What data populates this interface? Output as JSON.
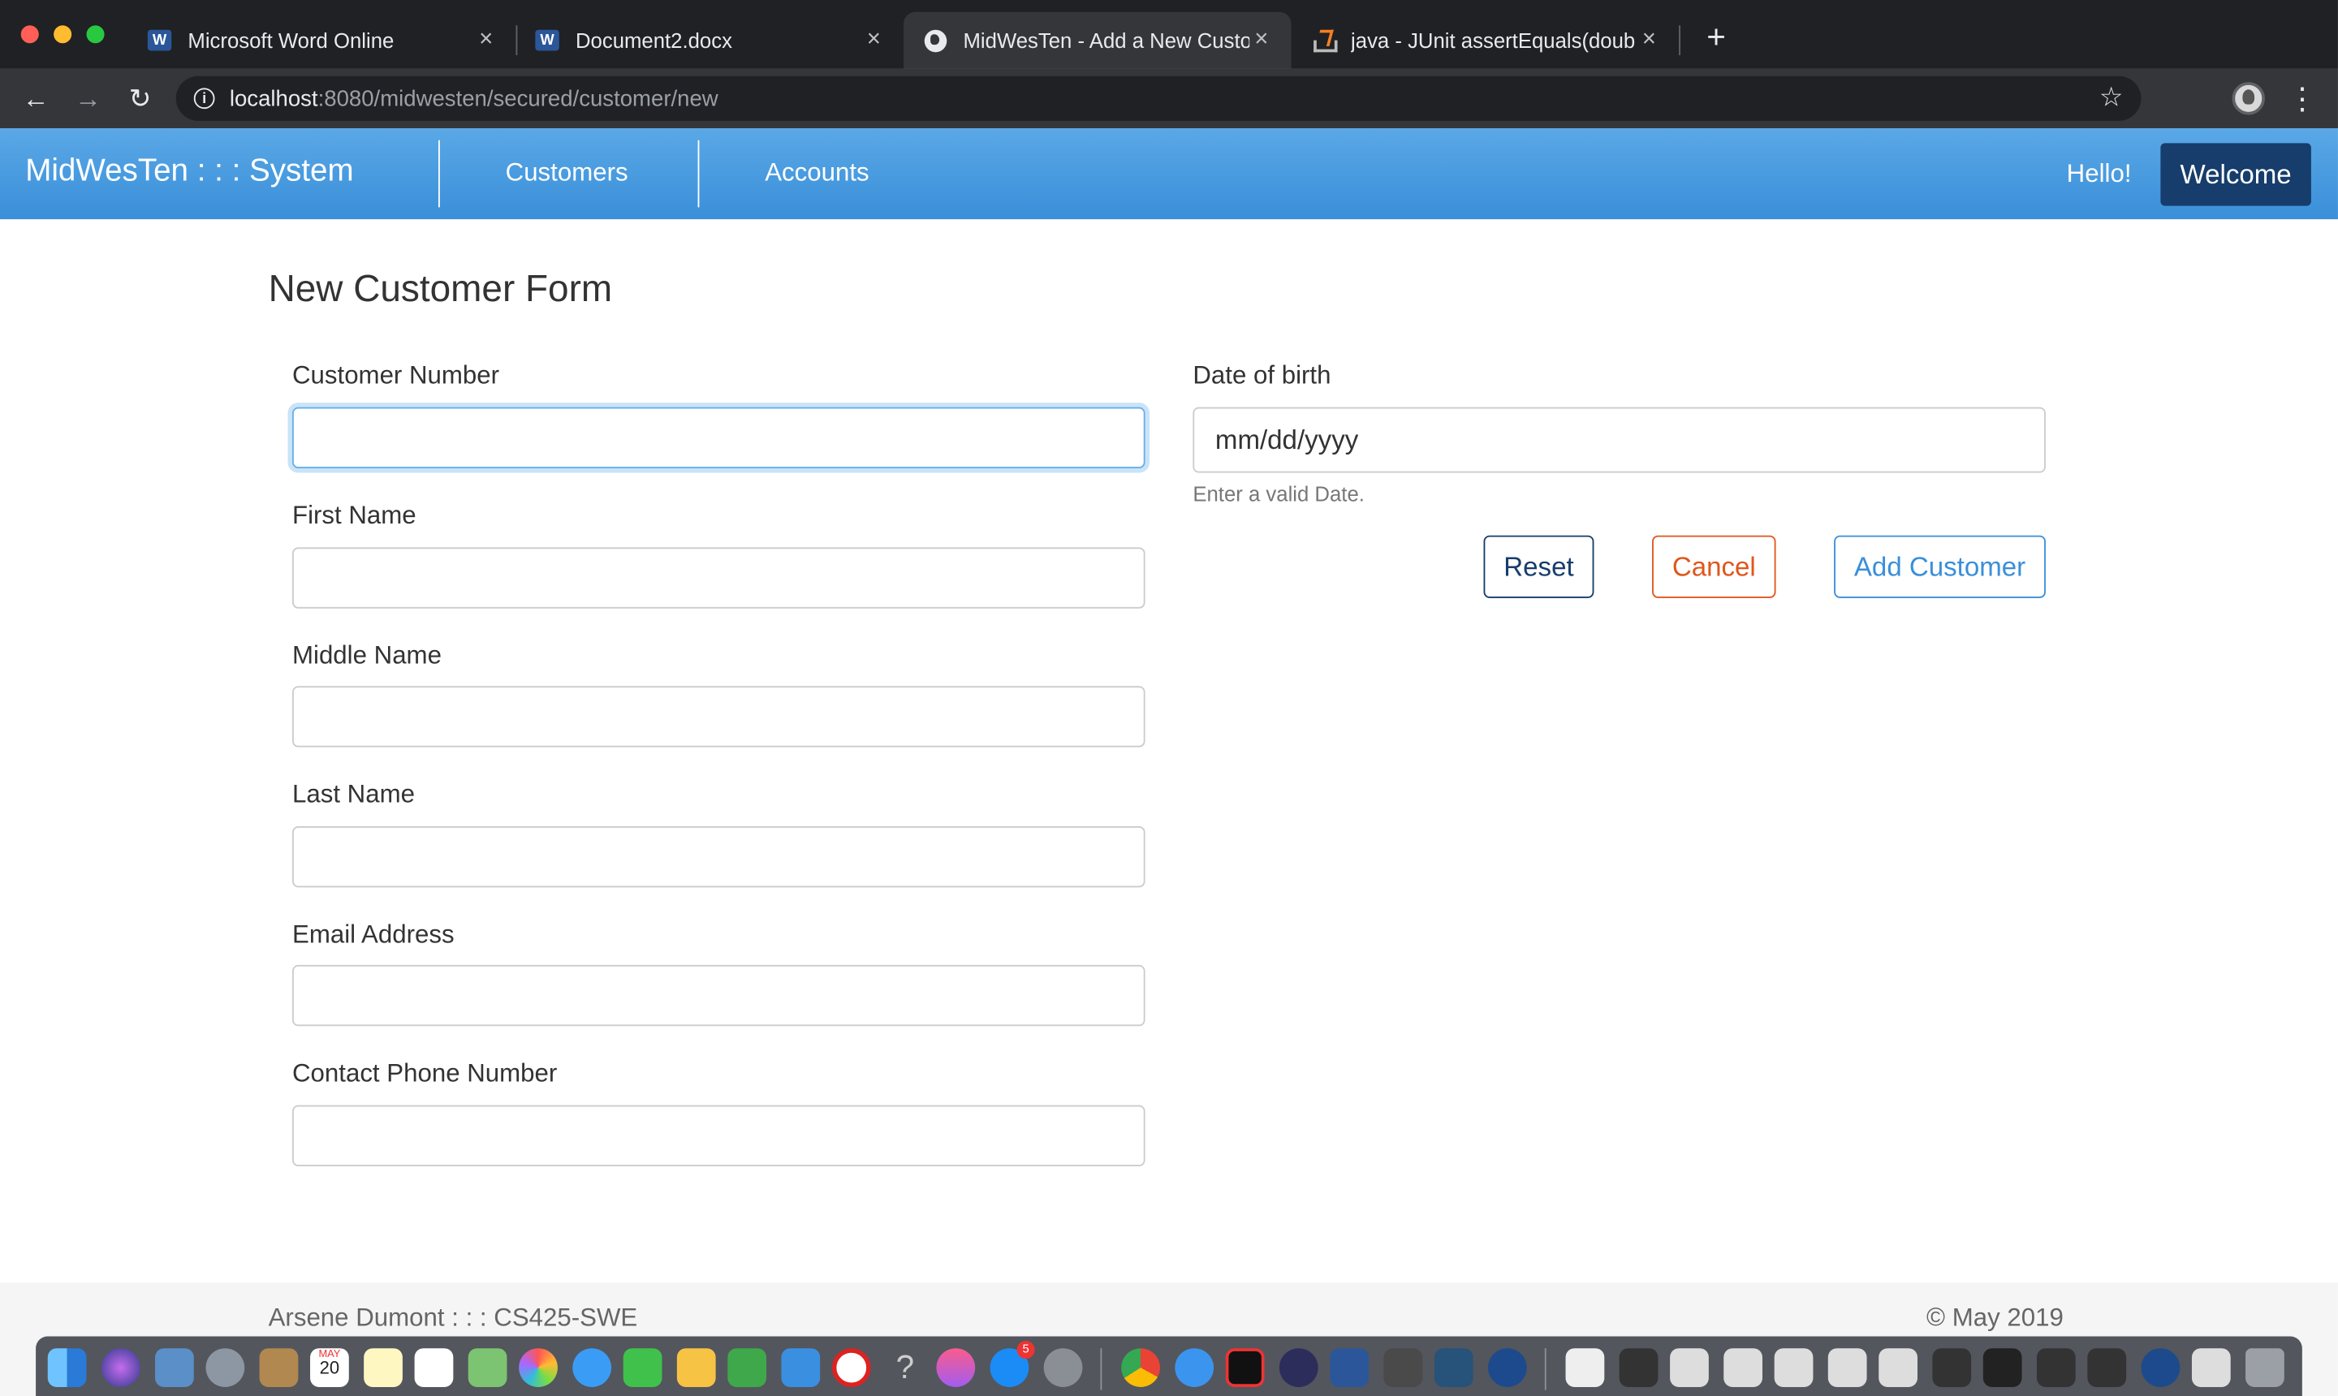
{
  "browser": {
    "tabs": [
      {
        "label": "Microsoft Word Online",
        "icon": "word-icon"
      },
      {
        "label": "Document2.docx",
        "icon": "word-icon"
      },
      {
        "label": "MidWesTen - Add a New Custo",
        "icon": "globe-icon"
      },
      {
        "label": "java - JUnit assertEquals(doub",
        "icon": "stackoverflow-icon"
      }
    ],
    "tab_close": "×",
    "new_tab": "+",
    "url_host": "localhost",
    "url_path": ":8080/midwesten/secured/customer/new"
  },
  "navbar": {
    "brand": "MidWesTen : : : System",
    "links": [
      "Customers",
      "Accounts"
    ],
    "hello": "Hello!",
    "welcome": "Welcome",
    "accent": "#3a8fd9",
    "dark": "#163d6b"
  },
  "form": {
    "title": "New Customer Form",
    "fields": [
      {
        "label": "Customer Number",
        "value": ""
      },
      {
        "label": "First Name",
        "value": ""
      },
      {
        "label": "Middle Name",
        "value": ""
      },
      {
        "label": "Last Name",
        "value": ""
      },
      {
        "label": "Email Address",
        "value": ""
      },
      {
        "label": "Contact Phone Number",
        "value": ""
      }
    ],
    "dob_label": "Date of birth",
    "dob_placeholder": "mm/dd/yyyy",
    "dob_help": "Enter a valid Date.",
    "buttons": {
      "reset": "Reset",
      "cancel": "Cancel",
      "add": "Add Customer"
    }
  },
  "footer": {
    "left": "Arsene Dumont : : : CS425-SWE",
    "right": "© May 2019"
  },
  "dock": {
    "calendar_month": "MAY",
    "calendar_day": "20",
    "badge": "5"
  }
}
